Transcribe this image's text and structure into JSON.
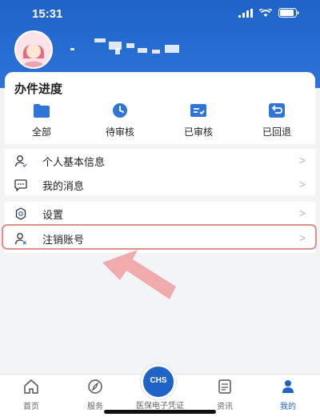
{
  "status": {
    "time": "15:31"
  },
  "progress": {
    "title": "办件进度",
    "items": [
      {
        "label": "全部",
        "icon": "folder-icon"
      },
      {
        "label": "待审核",
        "icon": "clock-icon"
      },
      {
        "label": "已审核",
        "icon": "checked-list-icon"
      },
      {
        "label": "已回退",
        "icon": "return-icon"
      }
    ]
  },
  "menu": {
    "group1": [
      {
        "label": "个人基本信息",
        "icon": "user-icon"
      },
      {
        "label": "我的消息",
        "icon": "message-icon"
      }
    ],
    "group2": [
      {
        "label": "设置",
        "icon": "gear-icon"
      },
      {
        "label": "注销账号",
        "icon": "user-remove-icon"
      }
    ],
    "chevron": ">"
  },
  "tabbar": {
    "tabs": [
      {
        "label": "首页",
        "icon": "home-icon"
      },
      {
        "label": "服务",
        "icon": "compass-icon"
      },
      {
        "label": "医保电子凭证",
        "icon": "qr-card-icon"
      },
      {
        "label": "资讯",
        "icon": "news-icon"
      },
      {
        "label": "我的",
        "icon": "profile-icon"
      }
    ],
    "center_badge": "CHS"
  },
  "colors": {
    "primary": "#1f63c9",
    "highlight": "#e58e8e",
    "arrow": "#f0a4a4"
  }
}
